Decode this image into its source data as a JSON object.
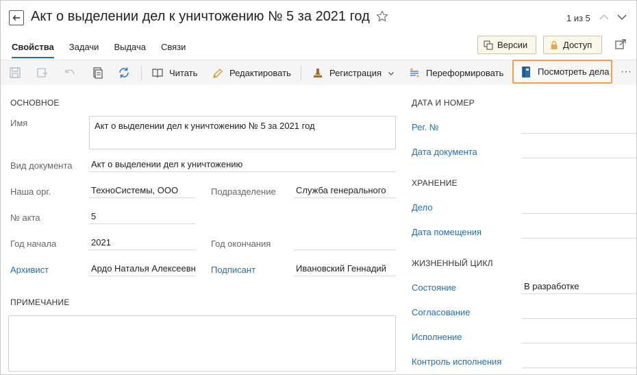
{
  "header": {
    "title": "Акт о выделении дел к уничтожению № 5 за 2021 год",
    "pager": "1 из 5"
  },
  "tabs": [
    {
      "label": "Свойства"
    },
    {
      "label": "Задачи"
    },
    {
      "label": "Выдача"
    },
    {
      "label": "Связи"
    }
  ],
  "header_buttons": {
    "versions": "Версии",
    "access": "Доступ"
  },
  "toolbar": {
    "read": "Читать",
    "edit": "Редактировать",
    "registration": "Регистрация",
    "reformat": "Переформировать",
    "view_cases": "Посмотреть дела"
  },
  "main": {
    "section_title": "ОСНОВНОЕ",
    "name_label": "Имя",
    "name_value": "Акт о выделении дел к уничтожению № 5 за 2021 год",
    "doc_type_label": "Вид документа",
    "doc_type_value": "Акт о выделении дел к уничтожению",
    "org_label": "Наша орг.",
    "org_value": "ТехноСистемы, ООО",
    "dept_label": "Подразделение",
    "dept_value": "Служба генерального",
    "act_no_label": "№ акта",
    "act_no_value": "5",
    "year_start_label": "Год начала",
    "year_start_value": "2021",
    "year_end_label": "Год окончания",
    "year_end_value": "",
    "archivist_label": "Архивист",
    "archivist_value": "Ардо Наталья Алексеевна",
    "signer_label": "Подписант",
    "signer_value": "Ивановский Геннадий",
    "note_title": "ПРИМЕЧАНИЕ",
    "note_value": ""
  },
  "side": {
    "date_number_title": "ДАТА И НОМЕР",
    "reg_no_label": "Рег. №",
    "doc_date_label": "Дата документа",
    "storage_title": "ХРАНЕНИЕ",
    "case_label": "Дело",
    "placed_date_label": "Дата помещения",
    "lifecycle_title": "ЖИЗНЕННЫЙ ЦИКЛ",
    "state_label": "Состояние",
    "state_value": "В разработке",
    "approval_label": "Согласование",
    "execution_label": "Исполнение",
    "control_label": "Контроль исполнения"
  },
  "colors": {
    "link": "#1f6fb5",
    "highlight_border": "#f0a14b",
    "header_button_bg": "#fbf8ea"
  },
  "icons": [
    "back-arrow-icon",
    "star-icon",
    "chevron-up-icon",
    "chevron-down-icon",
    "versions-icon",
    "lock-icon",
    "open-external-icon",
    "save-icon",
    "save-as-icon",
    "undo-icon",
    "copy-icon",
    "refresh-icon",
    "book-icon",
    "pencil-icon",
    "stamp-icon",
    "reformat-icon",
    "binder-icon",
    "more-icon"
  ]
}
